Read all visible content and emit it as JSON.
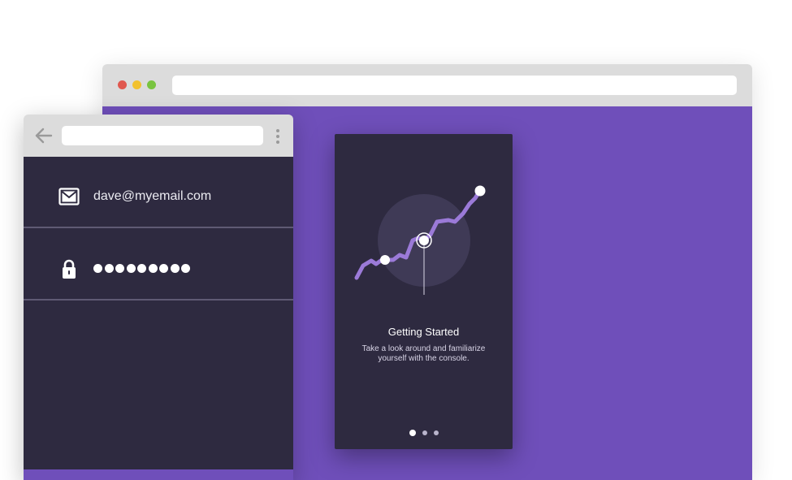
{
  "desktop_window": {
    "address_bar": "",
    "colors": {
      "bar": "#dcdcdc",
      "body": "#6f4fba"
    }
  },
  "onboarding_card": {
    "title": "Getting Started",
    "subtitle": "Take a look around and familiarize yourself with the console.",
    "pager": {
      "total": 3,
      "active": 0
    },
    "illustration": "rising-line-chart"
  },
  "mobile_window": {
    "address_bar": "",
    "email": {
      "icon": "envelope-icon",
      "value": "dave@myemail.com"
    },
    "password": {
      "icon": "lock-icon",
      "masked_length": 9
    }
  },
  "colors": {
    "accent": "#9b7ad8",
    "dark_panel": "#2e2a40",
    "purple_bg": "#6f4fba"
  }
}
